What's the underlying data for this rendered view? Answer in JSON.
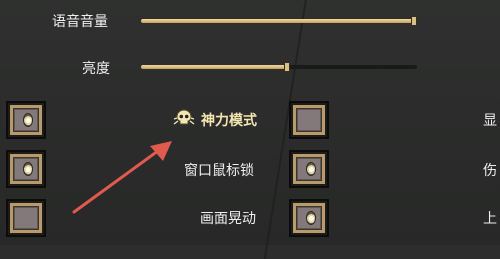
{
  "settings": {
    "voice_volume_label": "语音音量",
    "voice_volume_level": 1.0,
    "brightness_label": "亮度",
    "brightness_level": 0.53,
    "god_mode_label": "神力模式",
    "window_mouse_lock_label": "窗口鼠标锁",
    "screen_shake_label": "画面晃动",
    "right_col_labels": [
      "显",
      "伤",
      "上"
    ]
  },
  "checkboxes": {
    "left": [
      true,
      true,
      false
    ],
    "middle": [
      false,
      true,
      true
    ]
  },
  "colors": {
    "slider_fill": "#e3c98a",
    "box_frame": "#b99a6a",
    "arrow": "#e05a4e",
    "god_mode_text": "#f4e6b0"
  }
}
